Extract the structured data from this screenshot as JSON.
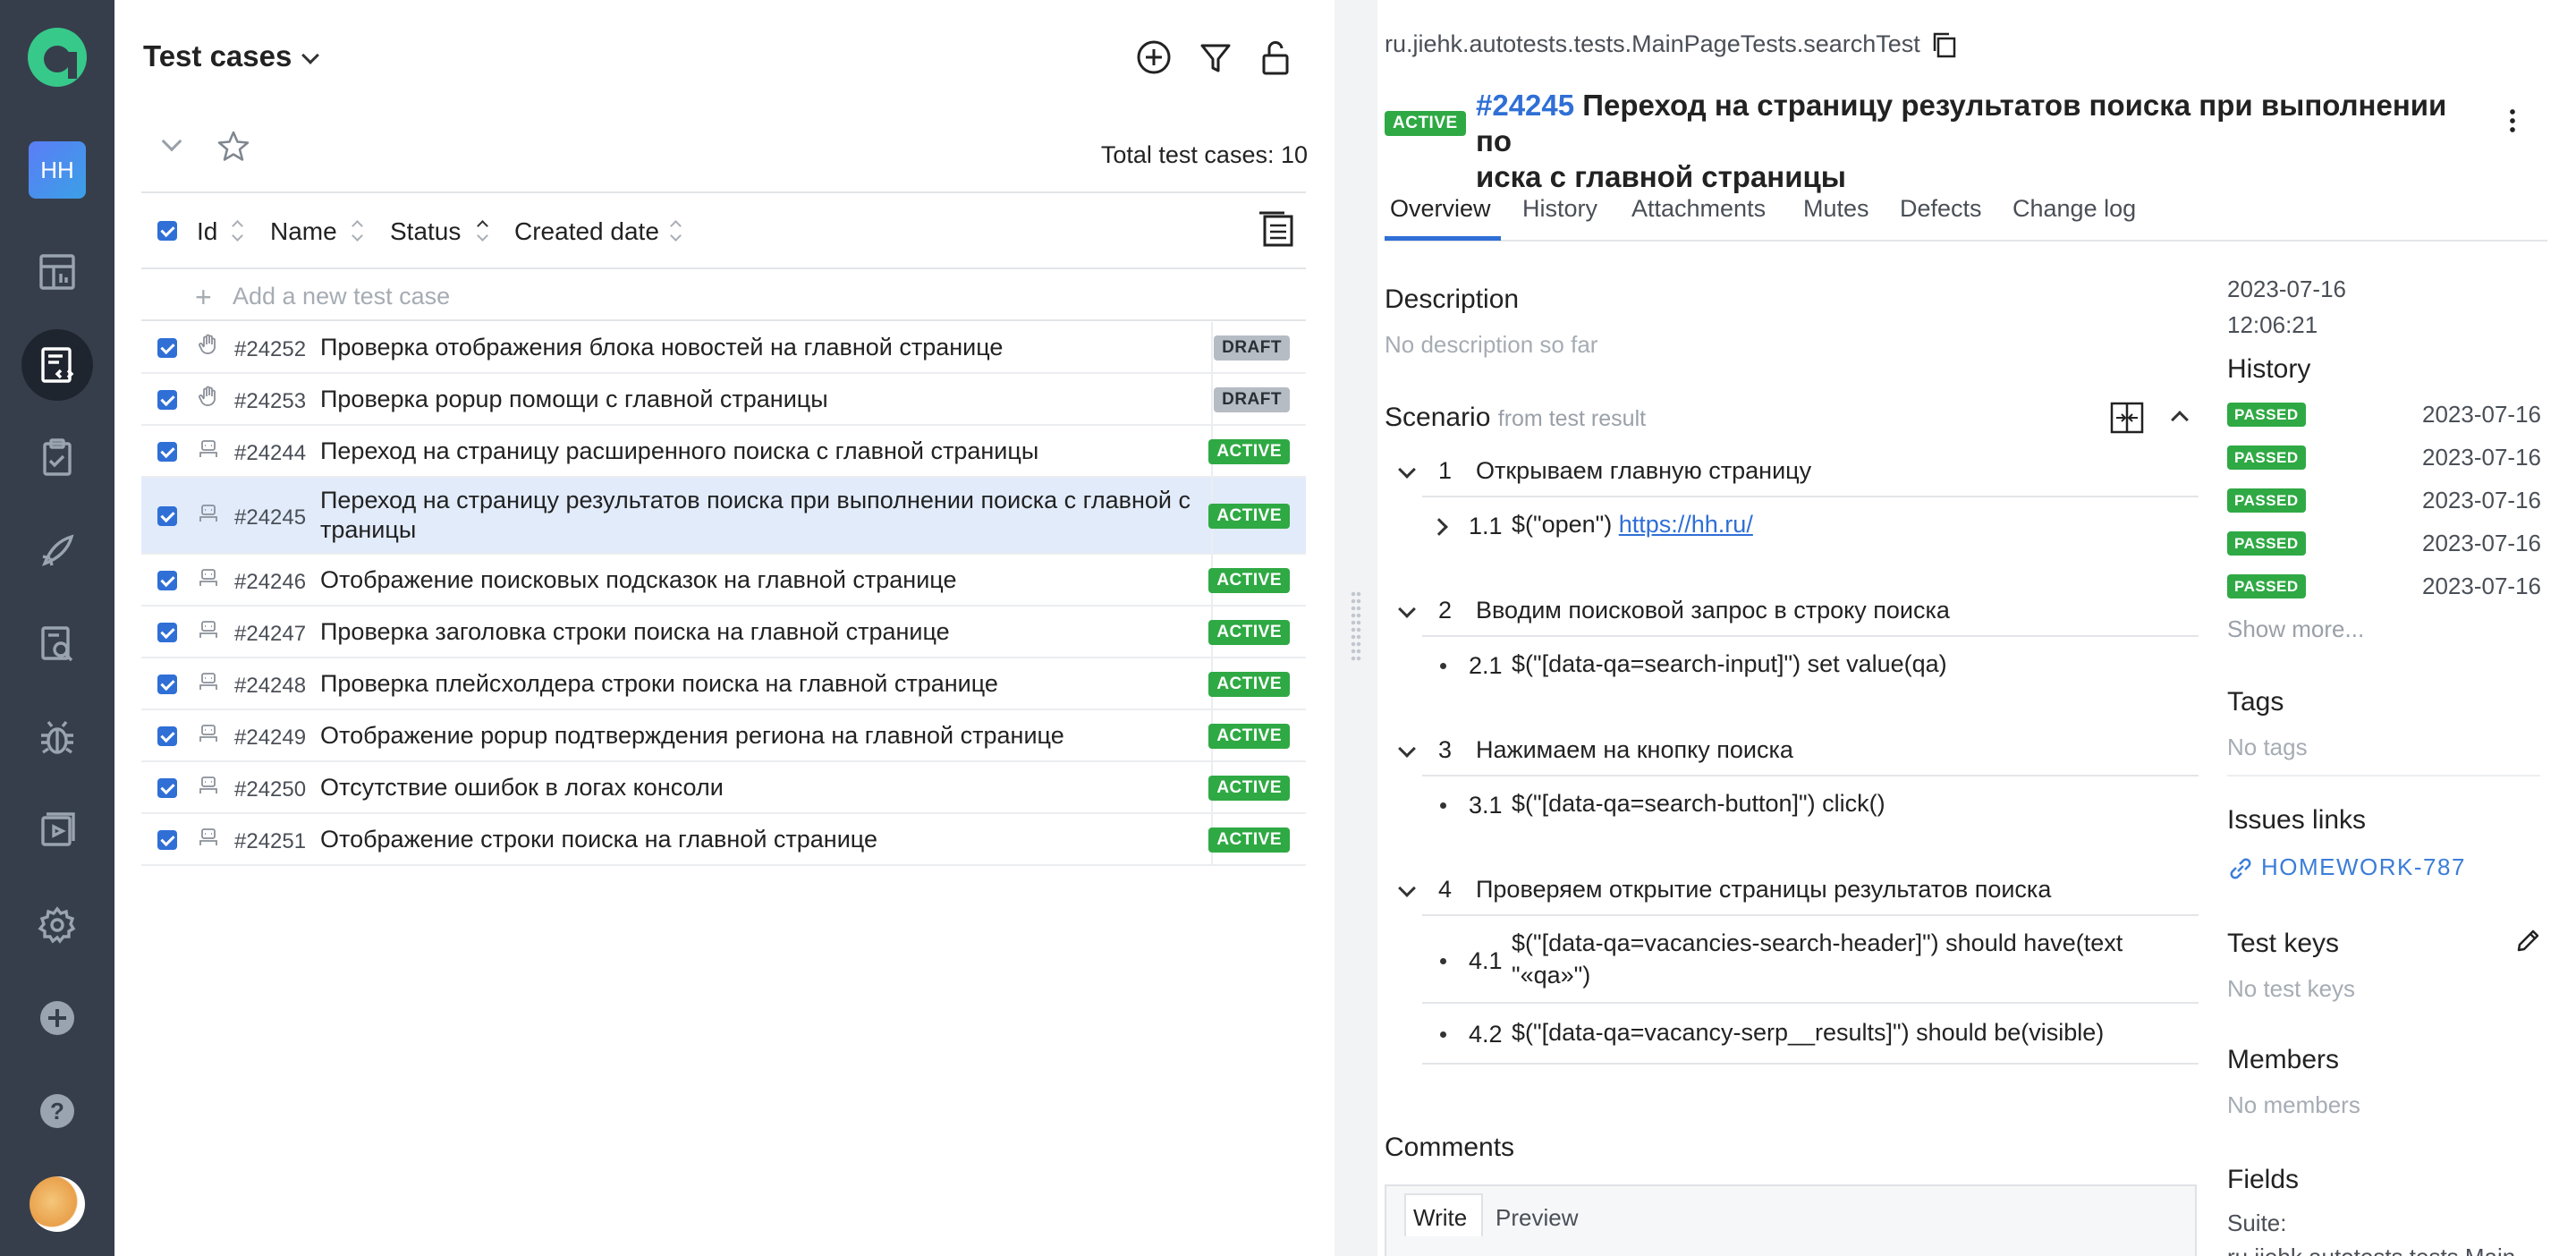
{
  "sidebar": {
    "items": [
      "home-logo",
      "avatar-hh",
      "dashboard",
      "test-cases",
      "test-plans",
      "launches",
      "analytics",
      "defects",
      "jobs",
      "settings",
      "add",
      "help",
      "user-avatar"
    ],
    "avatar_initials": "HH"
  },
  "left": {
    "title": "Test cases",
    "total_label": "Total test cases: 10",
    "columns": {
      "id": "Id",
      "name": "Name",
      "status": "Status",
      "created": "Created date"
    },
    "add_placeholder": "Add a new test case",
    "rows": [
      {
        "id": "#24252",
        "name": "Проверка отображения блока новостей на главной странице",
        "status": "DRAFT",
        "type": "manual"
      },
      {
        "id": "#24253",
        "name": "Проверка popup помощи с главной страницы",
        "status": "DRAFT",
        "type": "manual"
      },
      {
        "id": "#24244",
        "name": "Переход на страницу расширенного поиска с главной страницы",
        "status": "ACTIVE",
        "type": "auto"
      },
      {
        "id": "#24245",
        "name": "Переход на страницу результатов поиска при выполнении поиска с главной с",
        "name2": "траницы",
        "status": "ACTIVE",
        "type": "auto"
      },
      {
        "id": "#24246",
        "name": "Отображение поисковых подсказок на главной странице",
        "status": "ACTIVE",
        "type": "auto"
      },
      {
        "id": "#24247",
        "name": "Проверка заголовка строки поиска на главной странице",
        "status": "ACTIVE",
        "type": "auto"
      },
      {
        "id": "#24248",
        "name": "Проверка плейсхолдера строки поиска на главной странице",
        "status": "ACTIVE",
        "type": "auto"
      },
      {
        "id": "#24249",
        "name": "Отображение popup подтверждения региона на главной странице",
        "status": "ACTIVE",
        "type": "auto"
      },
      {
        "id": "#24250",
        "name": "Отсутствие ошибок в логах консоли",
        "status": "ACTIVE",
        "type": "auto"
      },
      {
        "id": "#24251",
        "name": "Отображение строки поиска на главной странице",
        "status": "ACTIVE",
        "type": "auto"
      }
    ]
  },
  "right": {
    "path": "ru.jiehk.autotests.tests.MainPageTests.searchTest",
    "status": "ACTIVE",
    "number": "#24245",
    "title1": "Переход на страницу результатов поиска при выполнении по",
    "title2": "иска с главной страницы",
    "tabs": [
      "Overview",
      "History",
      "Attachments",
      "Mutes",
      "Defects",
      "Change log"
    ],
    "description_heading": "Description",
    "description_text": "No description so far",
    "scenario_heading": "Scenario",
    "scenario_source": "from test result",
    "steps": [
      {
        "num": "1",
        "text": "Открываем главную страницу",
        "sub": [
          {
            "num": "1.1",
            "text": "$(\"open\") ",
            "link": "https://hh.ru/"
          }
        ]
      },
      {
        "num": "2",
        "text": "Вводим поисковой запрос в строку поиска",
        "sub": [
          {
            "num": "2.1",
            "text": "$(\"[data-qa=search-input]\") set value(qa)"
          }
        ]
      },
      {
        "num": "3",
        "text": "Нажимаем на кнопку поиска",
        "sub": [
          {
            "num": "3.1",
            "text": "$(\"[data-qa=search-button]\") click()"
          }
        ]
      },
      {
        "num": "4",
        "text": "Проверяем открытие страницы результатов поиска",
        "sub": [
          {
            "num": "4.1",
            "text": "$(\"[data-qa=vacancies-search-header]\") should have(text",
            "text2": "\"«qa»\")"
          },
          {
            "num": "4.2",
            "text": "$(\"[data-qa=vacancy-serp__results]\") should be(visible)"
          }
        ]
      }
    ],
    "comments_heading": "Comments",
    "comment_tabs": [
      "Write",
      "Preview"
    ],
    "meta": {
      "date": "2023-07-16",
      "time": "12:06:21",
      "history_heading": "History",
      "history": [
        {
          "status": "PASSED",
          "date": "2023-07-16"
        },
        {
          "status": "PASSED",
          "date": "2023-07-16"
        },
        {
          "status": "PASSED",
          "date": "2023-07-16"
        },
        {
          "status": "PASSED",
          "date": "2023-07-16"
        },
        {
          "status": "PASSED",
          "date": "2023-07-16"
        }
      ],
      "show_more": "Show more...",
      "tags_heading": "Tags",
      "tags_empty": "No tags",
      "issues_heading": "Issues links",
      "issue": "HOMEWORK-787",
      "keys_heading": "Test keys",
      "keys_empty": "No test keys",
      "members_heading": "Members",
      "members_empty": "No members",
      "fields_heading": "Fields",
      "suite_label": "Suite:",
      "suite_value": "ru.jiehk.autotests.tests.Main"
    }
  },
  "colors": {
    "sidebar": "#363e4c",
    "accent": "#2f6fd6",
    "active": "#2fa944",
    "selected": "#e1ebfa"
  }
}
